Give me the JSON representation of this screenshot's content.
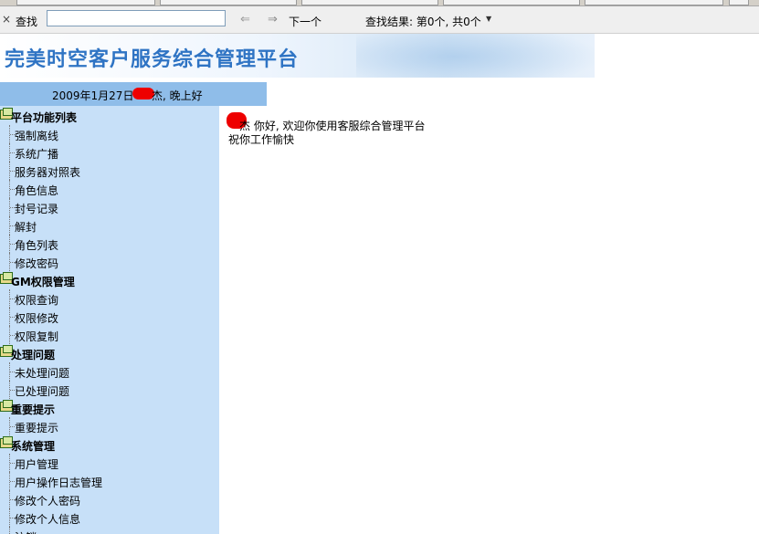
{
  "find_bar": {
    "close_glyph": "×",
    "label": "查找",
    "search_value": "",
    "next_label": "下一个",
    "result_text": "查找结果: 第0个, 共0个",
    "prev_icon": "arrow-left-icon",
    "next_icon": "arrow-right-icon",
    "dropdown_icon": "caret-down-icon"
  },
  "banner": {
    "title": "完美时空客户服务综合管理平台"
  },
  "user_bar": {
    "date": "2009年1月27日",
    "greeting": "杰, 晚上好"
  },
  "sidebar": {
    "groups": [
      {
        "title": "平台功能列表",
        "items": [
          "强制离线",
          "系统广播",
          "服务器对照表",
          "角色信息",
          "封号记录",
          "解封",
          "角色列表",
          "修改密码"
        ]
      },
      {
        "title": "GM权限管理",
        "items": [
          "权限查询",
          "权限修改",
          "权限复制"
        ]
      },
      {
        "title": "处理问题",
        "items": [
          "未处理问题",
          "已处理问题"
        ]
      },
      {
        "title": "重要提示",
        "items": [
          "重要提示"
        ]
      },
      {
        "title": "系统管理",
        "items": [
          "用户管理",
          "用户操作日志管理",
          "修改个人密码",
          "修改个人信息",
          "注销"
        ]
      }
    ]
  },
  "main": {
    "welcome": "杰 你好, 欢迎你使用客服综合管理平台",
    "wish": "祝你工作愉快"
  },
  "colors": {
    "sidebar_bg": "#c7e0f8",
    "userbar_bg": "#8fbde9",
    "banner_title": "#2f74c4",
    "redaction": "#ee0000"
  }
}
